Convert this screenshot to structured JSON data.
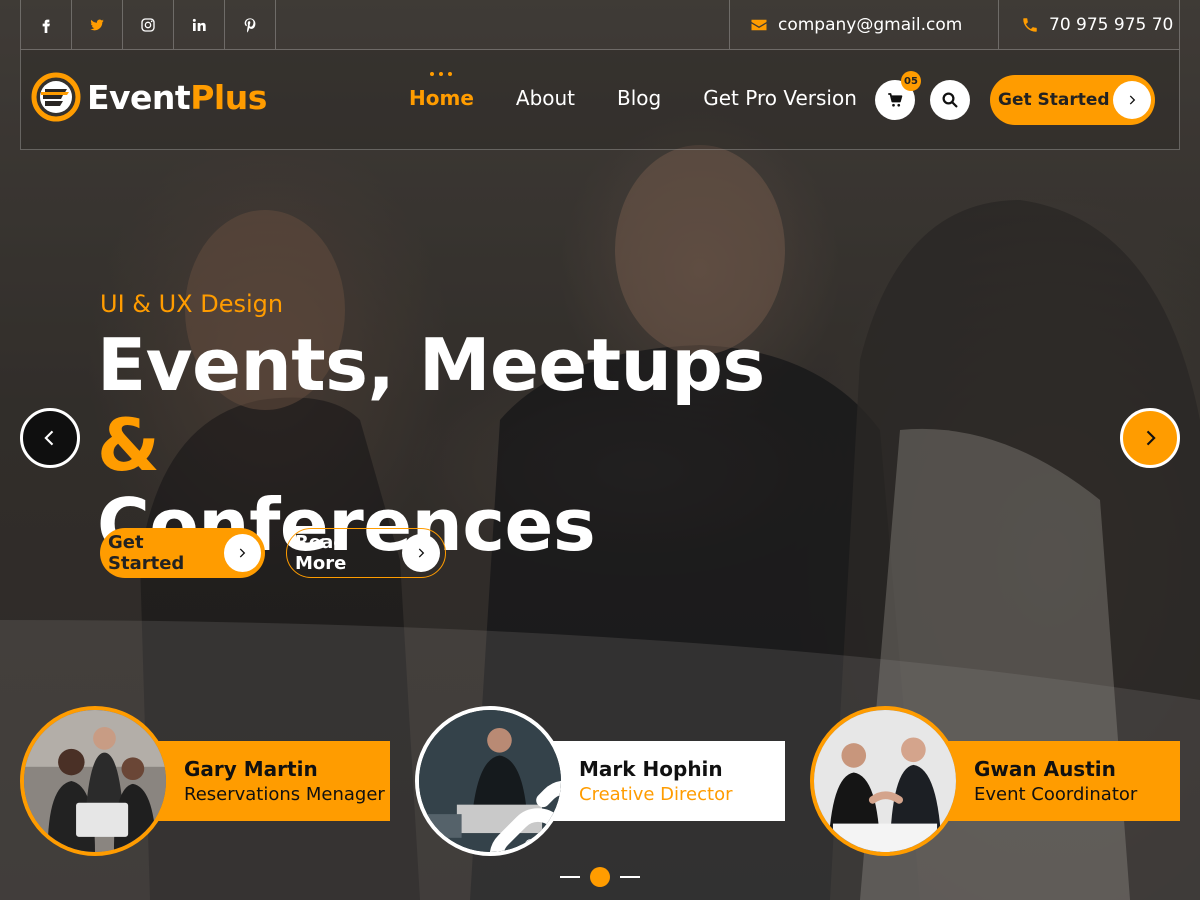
{
  "social": [
    {
      "name": "facebook",
      "glyph": "f"
    },
    {
      "name": "twitter",
      "glyph": "t"
    },
    {
      "name": "instagram",
      "glyph": "i"
    },
    {
      "name": "linkedin",
      "glyph": "in"
    },
    {
      "name": "pinterest",
      "glyph": "p"
    }
  ],
  "contact": {
    "email": "company@gmail.com",
    "phone": "70 975 975 70"
  },
  "logo": {
    "part1": "Event",
    "part2": "Plus"
  },
  "nav": [
    {
      "label": "Home",
      "active": true
    },
    {
      "label": "About",
      "active": false
    },
    {
      "label": "Blog",
      "active": false
    },
    {
      "label": "Get Pro Version",
      "active": false
    }
  ],
  "cart": {
    "count": "05"
  },
  "header_cta": "Get Started",
  "hero": {
    "eyebrow": "UI & UX Design",
    "line1": "Events, Meetups ",
    "amp": "&",
    "line2": "Conferences",
    "btn_primary": "Get Started",
    "btn_secondary": "Read More"
  },
  "team": [
    {
      "name": "Gary Martin",
      "role": "Reservations Menager",
      "box": "orange"
    },
    {
      "name": "Mark Hophin",
      "role": "Creative Director",
      "box": "white"
    },
    {
      "name": "Gwan Austin",
      "role": "Event Coordinator",
      "box": "orange"
    }
  ],
  "colors": {
    "accent": "#ff9c00",
    "white": "#ffffff",
    "dark": "#111111"
  }
}
